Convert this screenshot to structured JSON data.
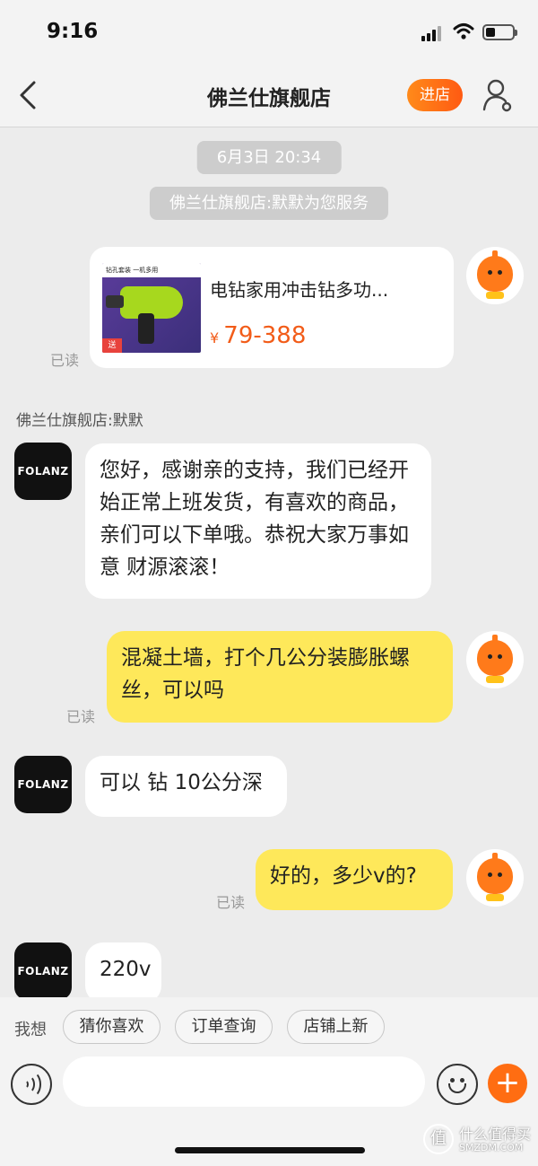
{
  "status_bar": {
    "time": "9:16"
  },
  "header": {
    "title": "佛兰仕旗舰店",
    "enter_shop": "进店"
  },
  "chat": {
    "timestamp": "6月3日 20:34",
    "service_note": "佛兰仕旗舰店:默默为您服务",
    "product_card": {
      "title": "电钻家用冲击钻多功...",
      "currency": "¥",
      "price": "79-388",
      "thumb_header": "钻孔套装 一机多用",
      "thumb_tag": "送"
    },
    "read_label": "已读",
    "shop_sender": "佛兰仕旗舰店:默默",
    "shop_avatar_text": "FOLANZ",
    "messages": {
      "m1": "您好，感谢亲的支持，我们已经开始正常上班发货，有喜欢的商品，亲们可以下单哦。恭祝大家万事如意 财源滚滚！",
      "m2": "混凝土墙，打个几公分装膨胀螺丝，可以吗",
      "m3": "可以 钻 10公分深",
      "m4": "好的，多少v的?",
      "m5": "220v"
    }
  },
  "quick_replies": {
    "prompt": "我想",
    "chips": [
      "猜你喜欢",
      "订单查询",
      "店铺上新"
    ]
  },
  "input_bar": {
    "placeholder": ""
  },
  "watermark": {
    "logo": "值",
    "line1": "什么值得买",
    "line2": "SMZDM.COM"
  },
  "colors": {
    "accent": "#ff6d12",
    "self_bubble": "#fee85a",
    "price": "#f25c19"
  }
}
